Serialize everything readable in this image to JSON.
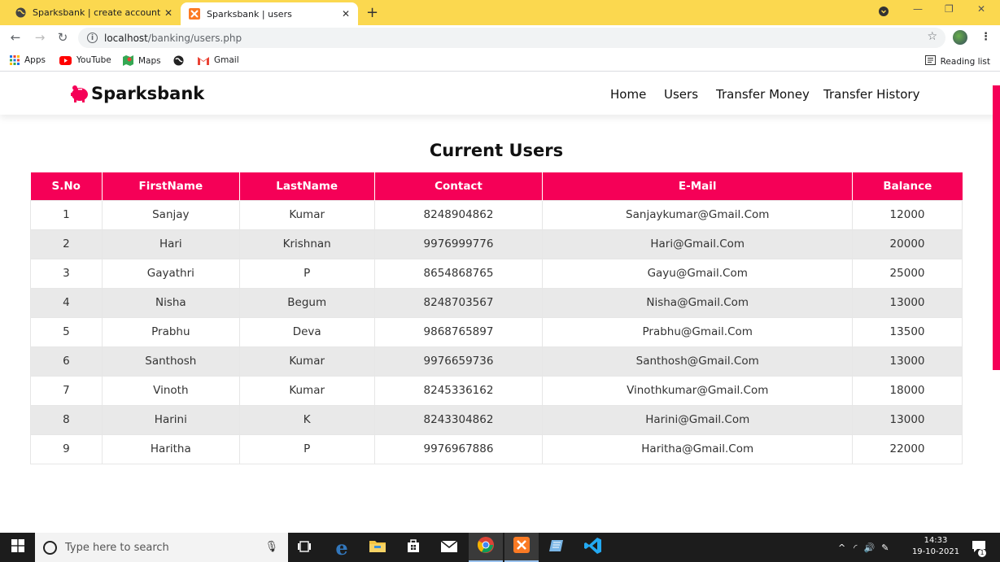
{
  "browser": {
    "tabs": [
      {
        "title": "Sparksbank | create account",
        "active": false
      },
      {
        "title": "Sparksbank | users",
        "active": true
      }
    ],
    "url_host": "localhost",
    "url_path": "/banking/users.php",
    "bookmarks": [
      {
        "label": "Apps",
        "icon": "apps-grid-icon"
      },
      {
        "label": "YouTube",
        "icon": "youtube-icon"
      },
      {
        "label": "Maps",
        "icon": "maps-icon"
      },
      {
        "label": "",
        "icon": "globe-icon"
      },
      {
        "label": "Gmail",
        "icon": "gmail-icon"
      }
    ],
    "reading_list": "Reading list"
  },
  "site": {
    "brand": "Sparksbank",
    "nav": [
      "Home",
      "Users",
      "Transfer Money",
      "Transfer History"
    ],
    "heading": "Current Users",
    "accent": "#f50057"
  },
  "table": {
    "headers": [
      "S.No",
      "FirstName",
      "LastName",
      "Contact",
      "E-Mail",
      "Balance"
    ],
    "rows": [
      [
        "1",
        "Sanjay",
        "Kumar",
        "8248904862",
        "Sanjaykumar@Gmail.Com",
        "12000"
      ],
      [
        "2",
        "Hari",
        "Krishnan",
        "9976999776",
        "Hari@Gmail.Com",
        "20000"
      ],
      [
        "3",
        "Gayathri",
        "P",
        "8654868765",
        "Gayu@Gmail.Com",
        "25000"
      ],
      [
        "4",
        "Nisha",
        "Begum",
        "8248703567",
        "Nisha@Gmail.Com",
        "13000"
      ],
      [
        "5",
        "Prabhu",
        "Deva",
        "9868765897",
        "Prabhu@Gmail.Com",
        "13500"
      ],
      [
        "6",
        "Santhosh",
        "Kumar",
        "9976659736",
        "Santhosh@Gmail.Com",
        "13000"
      ],
      [
        "7",
        "Vinoth",
        "Kumar",
        "8245336162",
        "Vinothkumar@Gmail.Com",
        "18000"
      ],
      [
        "8",
        "Harini",
        "K",
        "8243304862",
        "Harini@Gmail.Com",
        "13000"
      ],
      [
        "9",
        "Haritha",
        "P",
        "9976967886",
        "Haritha@Gmail.Com",
        "22000"
      ]
    ]
  },
  "taskbar": {
    "search_placeholder": "Type here to search",
    "time": "14:33",
    "date": "19-10-2021",
    "notification_count": "1"
  }
}
